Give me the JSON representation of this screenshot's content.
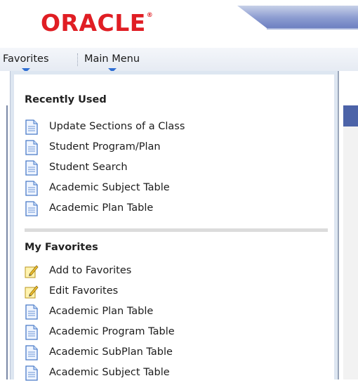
{
  "header": {
    "logo_text": "ORACLE",
    "logo_mark": "®"
  },
  "menubar": {
    "favorites_label": "Favorites",
    "main_menu_label": "Main Menu"
  },
  "dropdown": {
    "recently_used": {
      "title": "Recently Used",
      "items": [
        {
          "label": "Update Sections of a Class",
          "icon": "document-icon"
        },
        {
          "label": "Student Program/Plan",
          "icon": "document-icon"
        },
        {
          "label": "Student Search",
          "icon": "document-icon"
        },
        {
          "label": "Academic Subject Table",
          "icon": "document-icon"
        },
        {
          "label": "Academic Plan Table",
          "icon": "document-icon"
        }
      ]
    },
    "my_favorites": {
      "title": "My Favorites",
      "items": [
        {
          "label": "Add to Favorites",
          "icon": "pencil-note-icon"
        },
        {
          "label": "Edit Favorites",
          "icon": "pencil-note-icon"
        },
        {
          "label": "Academic Plan Table",
          "icon": "document-icon"
        },
        {
          "label": "Academic Program Table",
          "icon": "document-icon"
        },
        {
          "label": "Academic SubPlan Table",
          "icon": "document-icon"
        },
        {
          "label": "Academic Subject Table",
          "icon": "document-icon"
        }
      ]
    }
  },
  "colors": {
    "brand_red": "#e01e24",
    "menu_arrow": "#2f6ed3",
    "panel_bg": "#dde6f1",
    "accent_blue": "#4c63a8"
  }
}
